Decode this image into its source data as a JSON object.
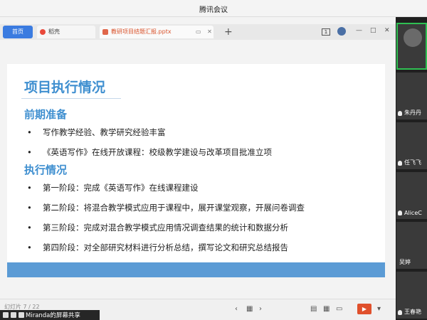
{
  "meeting": {
    "title": "腾讯会议"
  },
  "wps": {
    "tabs": [
      {
        "label": "首页"
      },
      {
        "label": "稻壳"
      },
      {
        "label": "教研项目结题汇报.pptx"
      }
    ],
    "window_badge": "1",
    "window_controls": [
      "—",
      "□",
      "✕"
    ]
  },
  "slide": {
    "title": "项目执行情况",
    "section1": {
      "heading": "前期准备",
      "items": [
        "写作教学经验、教学研究经验丰富",
        "《英语写作》在线开放课程：校级教学建设与改革项目批准立项"
      ]
    },
    "section2": {
      "heading": "执行情况",
      "items": [
        "第一阶段：完成《英语写作》在线课程建设",
        "第二阶段：将混合教学模式应用于课程中，展开课堂观察，开展问卷调查",
        "第三阶段：完成对混合教学模式应用情况调查结果的统计和数据分析",
        "第四阶段：对全部研究材料进行分析总结，撰写论文和研究总结报告"
      ]
    }
  },
  "status": {
    "page_indicator": "幻灯片 7 / 22"
  },
  "share": {
    "text": "Miranda的屏幕共享"
  },
  "participants": [
    {
      "name": "",
      "active": true
    },
    {
      "name": "朱丹丹",
      "mic": true
    },
    {
      "name": "任飞飞",
      "mic": true
    },
    {
      "name": "AliceC",
      "mic": true
    },
    {
      "name": "吴婷",
      "mic": false
    },
    {
      "name": "王春艳",
      "mic": true
    }
  ]
}
